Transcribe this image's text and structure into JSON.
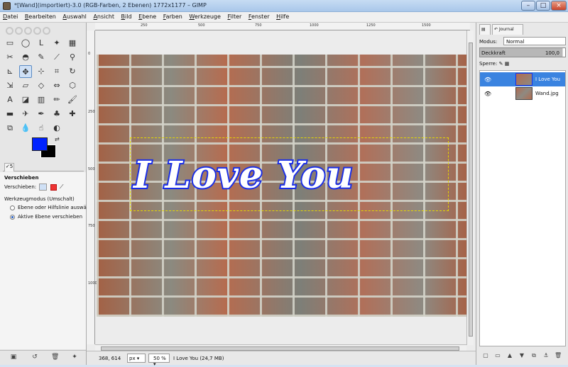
{
  "window": {
    "title": "*[Wand](importiert)-3.0 (RGB-Farben, 2 Ebenen) 1772x1177 – GIMP",
    "minimize": "–",
    "maximize": "□",
    "close": "×"
  },
  "menu": [
    "Datei",
    "Bearbeiten",
    "Auswahl",
    "Ansicht",
    "Bild",
    "Ebene",
    "Farben",
    "Werkzeuge",
    "Filter",
    "Fenster",
    "Hilfe"
  ],
  "toolbox": {
    "tools": [
      {
        "name": "rect-select-tool-icon",
        "glyph": "▭"
      },
      {
        "name": "ellipse-select-tool-icon",
        "glyph": "◯"
      },
      {
        "name": "free-select-tool-icon",
        "glyph": "ᒪ"
      },
      {
        "name": "fuzzy-select-tool-icon",
        "glyph": "✦"
      },
      {
        "name": "color-select-tool-icon",
        "glyph": "▦"
      },
      {
        "name": "scissors-tool-icon",
        "glyph": "✂"
      },
      {
        "name": "foreground-select-tool-icon",
        "glyph": "◓"
      },
      {
        "name": "paths-tool-icon",
        "glyph": "✎"
      },
      {
        "name": "color-picker-tool-icon",
        "glyph": "⟋"
      },
      {
        "name": "zoom-tool-icon",
        "glyph": "⚲"
      },
      {
        "name": "measure-tool-icon",
        "glyph": "⊾"
      },
      {
        "name": "move-tool-icon",
        "glyph": "✥"
      },
      {
        "name": "align-tool-icon",
        "glyph": "⊹"
      },
      {
        "name": "crop-tool-icon",
        "glyph": "⌗"
      },
      {
        "name": "rotate-tool-icon",
        "glyph": "↻"
      },
      {
        "name": "scale-tool-icon",
        "glyph": "⇲"
      },
      {
        "name": "shear-tool-icon",
        "glyph": "▱"
      },
      {
        "name": "perspective-tool-icon",
        "glyph": "◇"
      },
      {
        "name": "flip-tool-icon",
        "glyph": "⇔"
      },
      {
        "name": "cage-transform-tool-icon",
        "glyph": "⬡"
      },
      {
        "name": "text-tool-icon",
        "glyph": "A"
      },
      {
        "name": "bucket-fill-tool-icon",
        "glyph": "◪"
      },
      {
        "name": "blend-tool-icon",
        "glyph": "▥"
      },
      {
        "name": "pencil-tool-icon",
        "glyph": "✏"
      },
      {
        "name": "paintbrush-tool-icon",
        "glyph": "🖌"
      },
      {
        "name": "eraser-tool-icon",
        "glyph": "▬"
      },
      {
        "name": "airbrush-tool-icon",
        "glyph": "✈"
      },
      {
        "name": "ink-tool-icon",
        "glyph": "✒"
      },
      {
        "name": "clone-tool-icon",
        "glyph": "♣"
      },
      {
        "name": "heal-tool-icon",
        "glyph": "✚"
      },
      {
        "name": "perspective-clone-tool-icon",
        "glyph": "⧉"
      },
      {
        "name": "blur-tool-icon",
        "glyph": "💧"
      },
      {
        "name": "smudge-tool-icon",
        "glyph": "☝"
      },
      {
        "name": "dodge-burn-tool-icon",
        "glyph": "◐"
      }
    ],
    "active_tool": "move-tool-icon",
    "colors": {
      "foreground": "#0022ff",
      "background": "#000000"
    },
    "tab_label": "✓5",
    "options": {
      "title": "Verschieben",
      "move_label": "Verschieben:",
      "mode_label": "Werkzeugmodus (Umschalt)",
      "radio1": "Ebene oder Hilfslinie auswählen",
      "radio2": "Aktive Ebene verschieben"
    },
    "bottom_icons": [
      "save-icon",
      "restore-icon",
      "delete-icon",
      "reset-icon"
    ]
  },
  "rulers": {
    "h_ticks": [
      "250",
      "500",
      "750",
      "1000",
      "1250",
      "1500"
    ],
    "v_ticks": [
      "0",
      "250",
      "500",
      "750",
      "1000"
    ]
  },
  "canvas": {
    "text": "I Love You",
    "colors": {
      "text_fill": "#ffffff",
      "text_stroke": "#1a2ee6",
      "selection": "#e4d800"
    }
  },
  "statusbar": {
    "coords": "368, 614",
    "unit": "px ▾",
    "zoom": "50 % ▾",
    "info": "I Love You (24,7 MB)"
  },
  "dock": {
    "tabs": {
      "layers": "",
      "journal": "Journal"
    },
    "mode_label": "Modus:",
    "mode_value": "Normal",
    "opacity_label": "Deckkraft",
    "opacity_value": "100,0",
    "lock_label": "Sperre:",
    "layers": [
      {
        "name": "I Love You",
        "selected": true
      },
      {
        "name": "Wand.jpg",
        "selected": false
      }
    ],
    "bottom_icons": [
      "new-layer-icon",
      "new-group-icon",
      "raise-layer-icon",
      "lower-layer-icon",
      "duplicate-layer-icon",
      "anchor-layer-icon",
      "delete-layer-icon"
    ]
  }
}
